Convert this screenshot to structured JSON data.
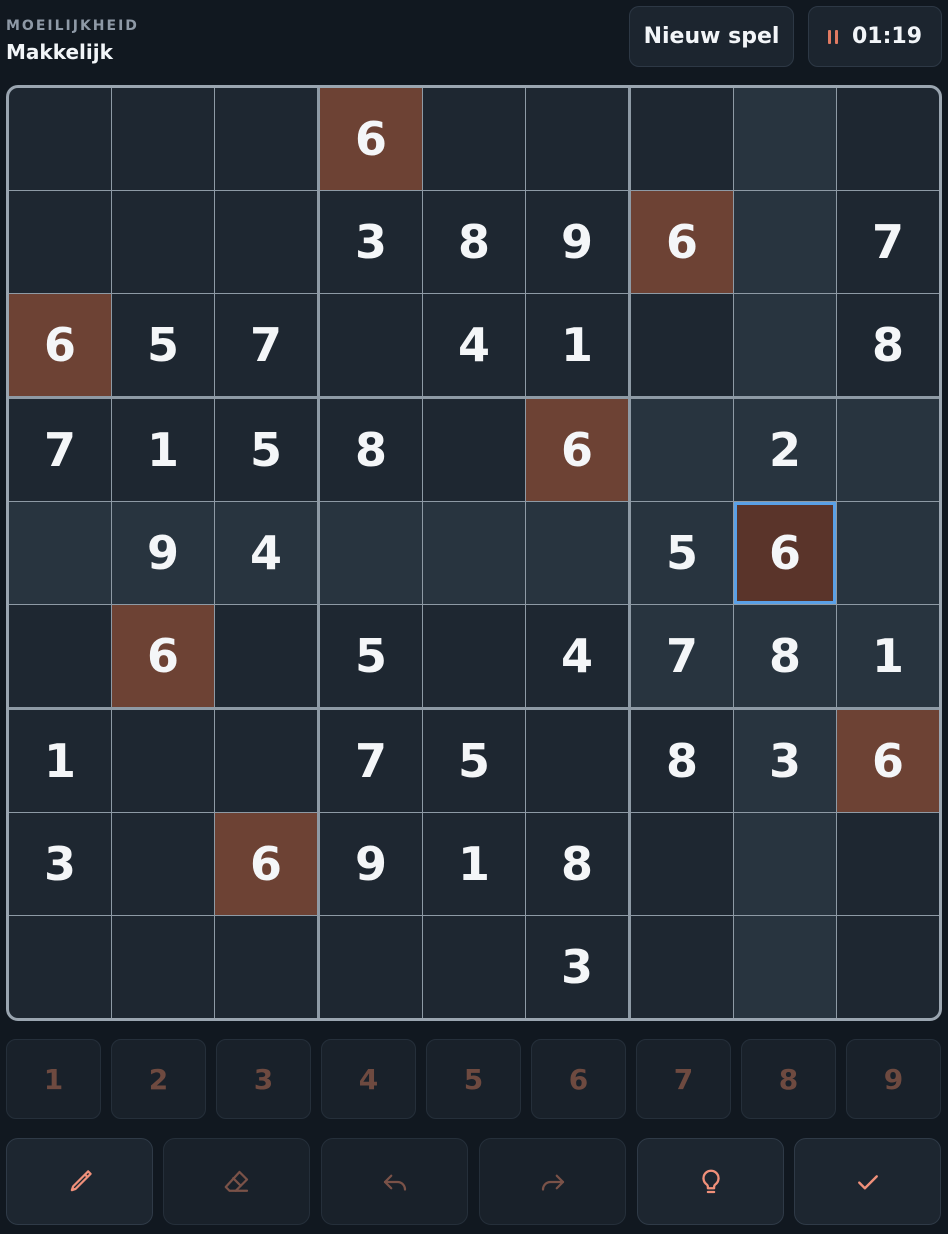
{
  "header": {
    "difficulty_caption": "MOEILIJKHEID",
    "difficulty_value": "Makkelijk",
    "new_game_label": "Nieuw spel",
    "timer": "01:19"
  },
  "board": {
    "rows": [
      [
        "",
        "",
        "",
        "6",
        "",
        "",
        "",
        "",
        ""
      ],
      [
        "",
        "",
        "",
        "3",
        "8",
        "9",
        "6",
        "",
        "7"
      ],
      [
        "6",
        "5",
        "7",
        "",
        "4",
        "1",
        "",
        "",
        "8"
      ],
      [
        "7",
        "1",
        "5",
        "8",
        "",
        "6",
        "",
        "2",
        ""
      ],
      [
        "",
        "9",
        "4",
        "",
        "",
        "",
        "5",
        "6",
        ""
      ],
      [
        "",
        "6",
        "",
        "5",
        "",
        "4",
        "7",
        "8",
        "1"
      ],
      [
        "1",
        "",
        "",
        "7",
        "5",
        "",
        "8",
        "3",
        "6"
      ],
      [
        "3",
        "",
        "6",
        "9",
        "1",
        "8",
        "",
        "",
        ""
      ],
      [
        "",
        "",
        "",
        "",
        "",
        "3",
        "",
        "",
        ""
      ]
    ],
    "selected": {
      "row": 4,
      "col": 7
    },
    "highlight_value": "6"
  },
  "numpad": [
    "1",
    "2",
    "3",
    "4",
    "5",
    "6",
    "7",
    "8",
    "9"
  ],
  "tools": [
    {
      "name": "pencil-button",
      "icon": "pencil-icon",
      "color": "#f0907a"
    },
    {
      "name": "erase-button",
      "icon": "eraser-icon",
      "color": "#7a5248"
    },
    {
      "name": "undo-button",
      "icon": "undo-icon",
      "color": "#7a5248"
    },
    {
      "name": "redo-button",
      "icon": "redo-icon",
      "color": "#7a5248"
    },
    {
      "name": "hint-button",
      "icon": "lightbulb-icon",
      "color": "#f0907a"
    },
    {
      "name": "check-button",
      "icon": "check-icon",
      "color": "#f0907a"
    }
  ],
  "colors": {
    "accent": "#f0907a",
    "same_value_cell": "#6d4234",
    "selected_border": "#5aa0e6"
  }
}
